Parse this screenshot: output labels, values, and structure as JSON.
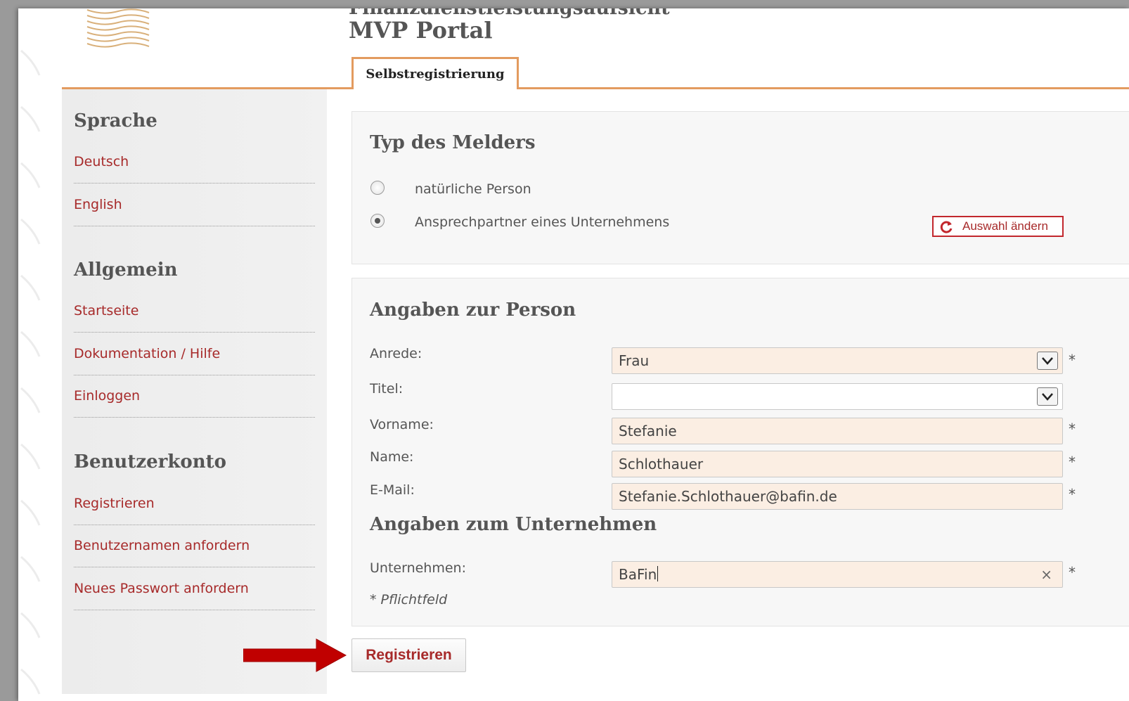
{
  "header": {
    "subtitle_partial": "Finanzdienstleistungsaufsicht",
    "title": "MVP Portal",
    "tab_label": "Selbstregistrierung"
  },
  "sidebar": {
    "sections": [
      {
        "heading": "Sprache",
        "items": [
          "Deutsch",
          "English"
        ]
      },
      {
        "heading": "Allgemein",
        "items": [
          "Startseite",
          "Dokumentation / Hilfe",
          "Einloggen"
        ]
      },
      {
        "heading": "Benutzerkonto",
        "items": [
          "Registrieren",
          "Benutzernamen anfordern",
          "Neues Passwort anfordern"
        ]
      }
    ]
  },
  "reporter_type": {
    "heading": "Typ des Melders",
    "options": [
      {
        "label": "natürliche Person",
        "selected": false
      },
      {
        "label": "Ansprechpartner eines Unternehmens",
        "selected": true
      }
    ],
    "change_button": "Auswahl ändern"
  },
  "person": {
    "heading": "Angaben zur Person",
    "fields": {
      "anrede": {
        "label": "Anrede:",
        "value": "Frau",
        "required": "*"
      },
      "titel": {
        "label": "Titel:",
        "value": ""
      },
      "vorname": {
        "label": "Vorname:",
        "value": "Stefanie",
        "required": "*"
      },
      "name": {
        "label": "Name:",
        "value": "Schlothauer",
        "required": "*"
      },
      "email": {
        "label": "E-Mail:",
        "value": "Stefanie.Schlothauer@bafin.de",
        "required": "*"
      }
    }
  },
  "company": {
    "heading": "Angaben zum Unternehmen",
    "label": "Unternehmen:",
    "value": "BaFin",
    "required": "*",
    "clear_glyph": "×"
  },
  "required_note": "* Pflichtfeld",
  "submit_label": "Registrieren",
  "colors": {
    "accent_orange": "#e39b5f",
    "link_red": "#a72a2a",
    "arrow_red": "#c00000",
    "field_fill": "#fbeee3"
  }
}
